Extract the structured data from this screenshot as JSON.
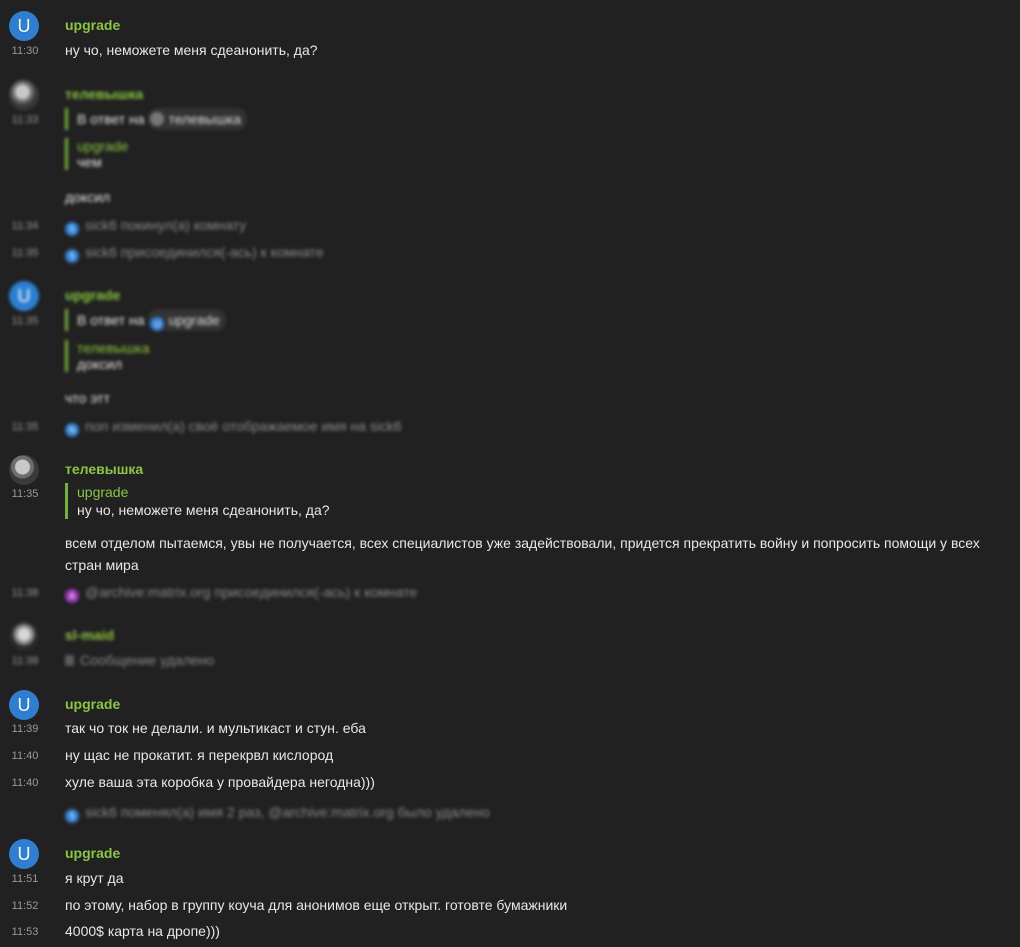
{
  "messages": [
    {
      "time": "11:30",
      "sender": "upgrade",
      "avatar_letter": "U",
      "text": "ну чо, неможете меня сдеанонить, да?"
    },
    {
      "time": "11:33",
      "sender": "телевышка",
      "in_reply_prefix": "В ответ на",
      "in_reply_to": "телевышка",
      "quote_name": "upgrade",
      "quote_text": "чем",
      "text": "доксил"
    },
    {
      "time": "11:34",
      "event": "sick6 покинул(а) комнату",
      "event_avatar": "S"
    },
    {
      "time": "11:35",
      "event": "sick6 присоединился(-ась) к комнате",
      "event_avatar": "S"
    },
    {
      "time": "11:35",
      "sender": "upgrade",
      "avatar_letter": "U",
      "in_reply_prefix": "В ответ на",
      "in_reply_to": "upgrade",
      "in_reply_avatar": "U",
      "quote_name": "телевышка",
      "quote_text": "доксил",
      "text": "что этт"
    },
    {
      "time": "11:35",
      "event": "non изменил(а) своё отображаемое имя на sick6",
      "event_avatar": "N"
    },
    {
      "time": "11:35",
      "sender": "телевышка",
      "quote_name": "upgrade",
      "quote_text": "ну чо, неможете меня сдеанонить, да?",
      "text": "всем отделом пытаемся, увы не получается, всех специалистов уже задействовали, придется прекратить войну и попросить помощи у всех стран мира"
    },
    {
      "time": "11:38",
      "event": "@archive:matrix.org присоединился(-ась) к комнате",
      "event_avatar": "A"
    },
    {
      "time": "11:38",
      "sender": "sl-maid",
      "text": "Сообщение удалено"
    },
    {
      "time": "11:39",
      "sender": "upgrade",
      "avatar_letter": "U",
      "text": "так чо ток не делали. и мультикаст и стун. еба"
    },
    {
      "time": "11:40",
      "text": "ну щас не прокатит. я перекрвл кислород"
    },
    {
      "time": "11:40",
      "text": "хуле ваша эта коробка у провайдера негодна)))"
    },
    {
      "event": "sick6 поменял(а) имя 2 раз, @archive:matrix.org было удалено",
      "event_avatar": "S"
    },
    {
      "time": "11:51",
      "sender": "upgrade",
      "avatar_letter": "U",
      "text": "я крут да"
    },
    {
      "time": "11:52",
      "text": "по этому, набор в группу коуча для анонимов еще открыт. готовте бумажники"
    },
    {
      "time": "11:53",
      "text": "4000$ карта на дропе)))"
    }
  ],
  "colors": {
    "background": "#212121",
    "sender": "#8cc63f",
    "reply_bar": "#6fb33a",
    "avatar_u": "#2e7fd1",
    "avatar_a": "#9b37b5"
  }
}
